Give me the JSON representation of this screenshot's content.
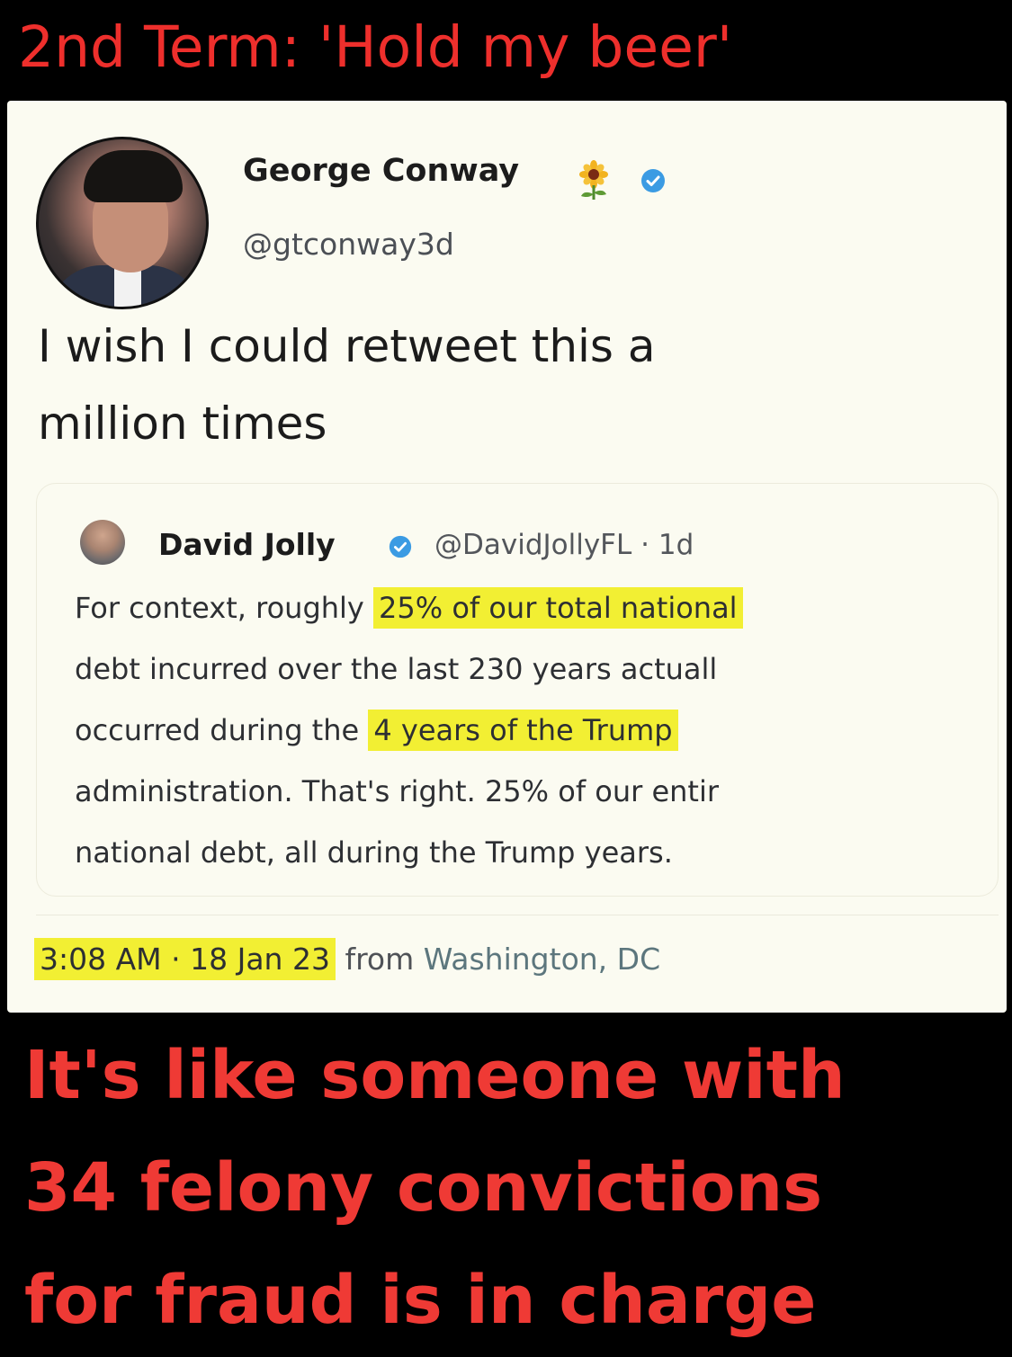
{
  "top_caption": "2nd Term: 'Hold my beer'",
  "tweet": {
    "author_name": "George Conway",
    "author_handle": "@gtconway3d",
    "text_lines": [
      "I wish I could retweet this a",
      "million times"
    ],
    "quoted": {
      "author_name": "David Jolly",
      "author_handle": "@DavidJollyFL",
      "age": "· 1d",
      "lines": [
        {
          "pre": "For context, roughly ",
          "hl": "25% of our total national",
          "post": ""
        },
        {
          "pre": "debt incurred over the last 230 years actuall",
          "hl": "",
          "post": ""
        },
        {
          "pre": "occurred during the ",
          "hl": "4 years of the Trump",
          "post": ""
        },
        {
          "pre": "administration. That's right. 25% of our entir",
          "hl": "",
          "post": ""
        },
        {
          "pre": "national debt, all during the Trump years.",
          "hl": "",
          "post": ""
        }
      ]
    },
    "timestamp": "3:08 AM · 18 Jan 23",
    "from_text": "from",
    "location": "Washington, DC"
  },
  "bottom_caption_lines": [
    "It's like someone with",
    "34 felony convictions",
    "for fraud is in charge"
  ],
  "colors": {
    "caption_red": "#ee2f2c",
    "highlight_yellow": "#f2ef33",
    "verified_blue": "#3b9be3",
    "card_background": "#fbfbf1"
  },
  "icons": {
    "author_emoji": "sunflower-icon",
    "verified": "verified-badge-icon"
  }
}
